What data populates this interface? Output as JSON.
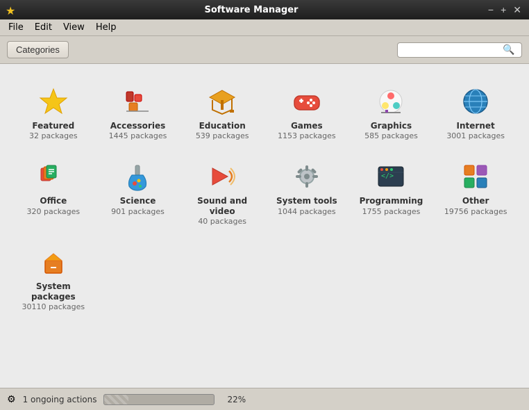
{
  "titlebar": {
    "title": "Software Manager",
    "app_icon": "★",
    "min_btn": "−",
    "max_btn": "+",
    "close_btn": "✕"
  },
  "menubar": {
    "items": [
      {
        "id": "file",
        "label": "File"
      },
      {
        "id": "edit",
        "label": "Edit"
      },
      {
        "id": "view",
        "label": "View"
      },
      {
        "id": "help",
        "label": "Help"
      }
    ]
  },
  "toolbar": {
    "categories_btn": "Categories",
    "search_placeholder": ""
  },
  "categories": [
    {
      "id": "featured",
      "name": "Featured",
      "count": "32 packages",
      "icon": "featured"
    },
    {
      "id": "accessories",
      "name": "Accessories",
      "count": "1445 packages",
      "icon": "accessories"
    },
    {
      "id": "education",
      "name": "Education",
      "count": "539 packages",
      "icon": "education"
    },
    {
      "id": "games",
      "name": "Games",
      "count": "1153 packages",
      "icon": "games"
    },
    {
      "id": "graphics",
      "name": "Graphics",
      "count": "585 packages",
      "icon": "graphics"
    },
    {
      "id": "internet",
      "name": "Internet",
      "count": "3001 packages",
      "icon": "internet"
    },
    {
      "id": "office",
      "name": "Office",
      "count": "320 packages",
      "icon": "office"
    },
    {
      "id": "science",
      "name": "Science",
      "count": "901 packages",
      "icon": "science"
    },
    {
      "id": "sound_video",
      "name": "Sound and video",
      "count": "40 packages",
      "icon": "sound_video"
    },
    {
      "id": "system_tools",
      "name": "System tools",
      "count": "1044 packages",
      "icon": "system_tools"
    },
    {
      "id": "programming",
      "name": "Programming",
      "count": "1755 packages",
      "icon": "programming"
    },
    {
      "id": "other",
      "name": "Other",
      "count": "19756 packages",
      "icon": "other"
    },
    {
      "id": "system_packages",
      "name": "System packages",
      "count": "30110 packages",
      "icon": "system_packages"
    }
  ],
  "statusbar": {
    "icon": "⚙",
    "text": "1 ongoing actions",
    "progress": 22,
    "progress_label": "22%"
  }
}
